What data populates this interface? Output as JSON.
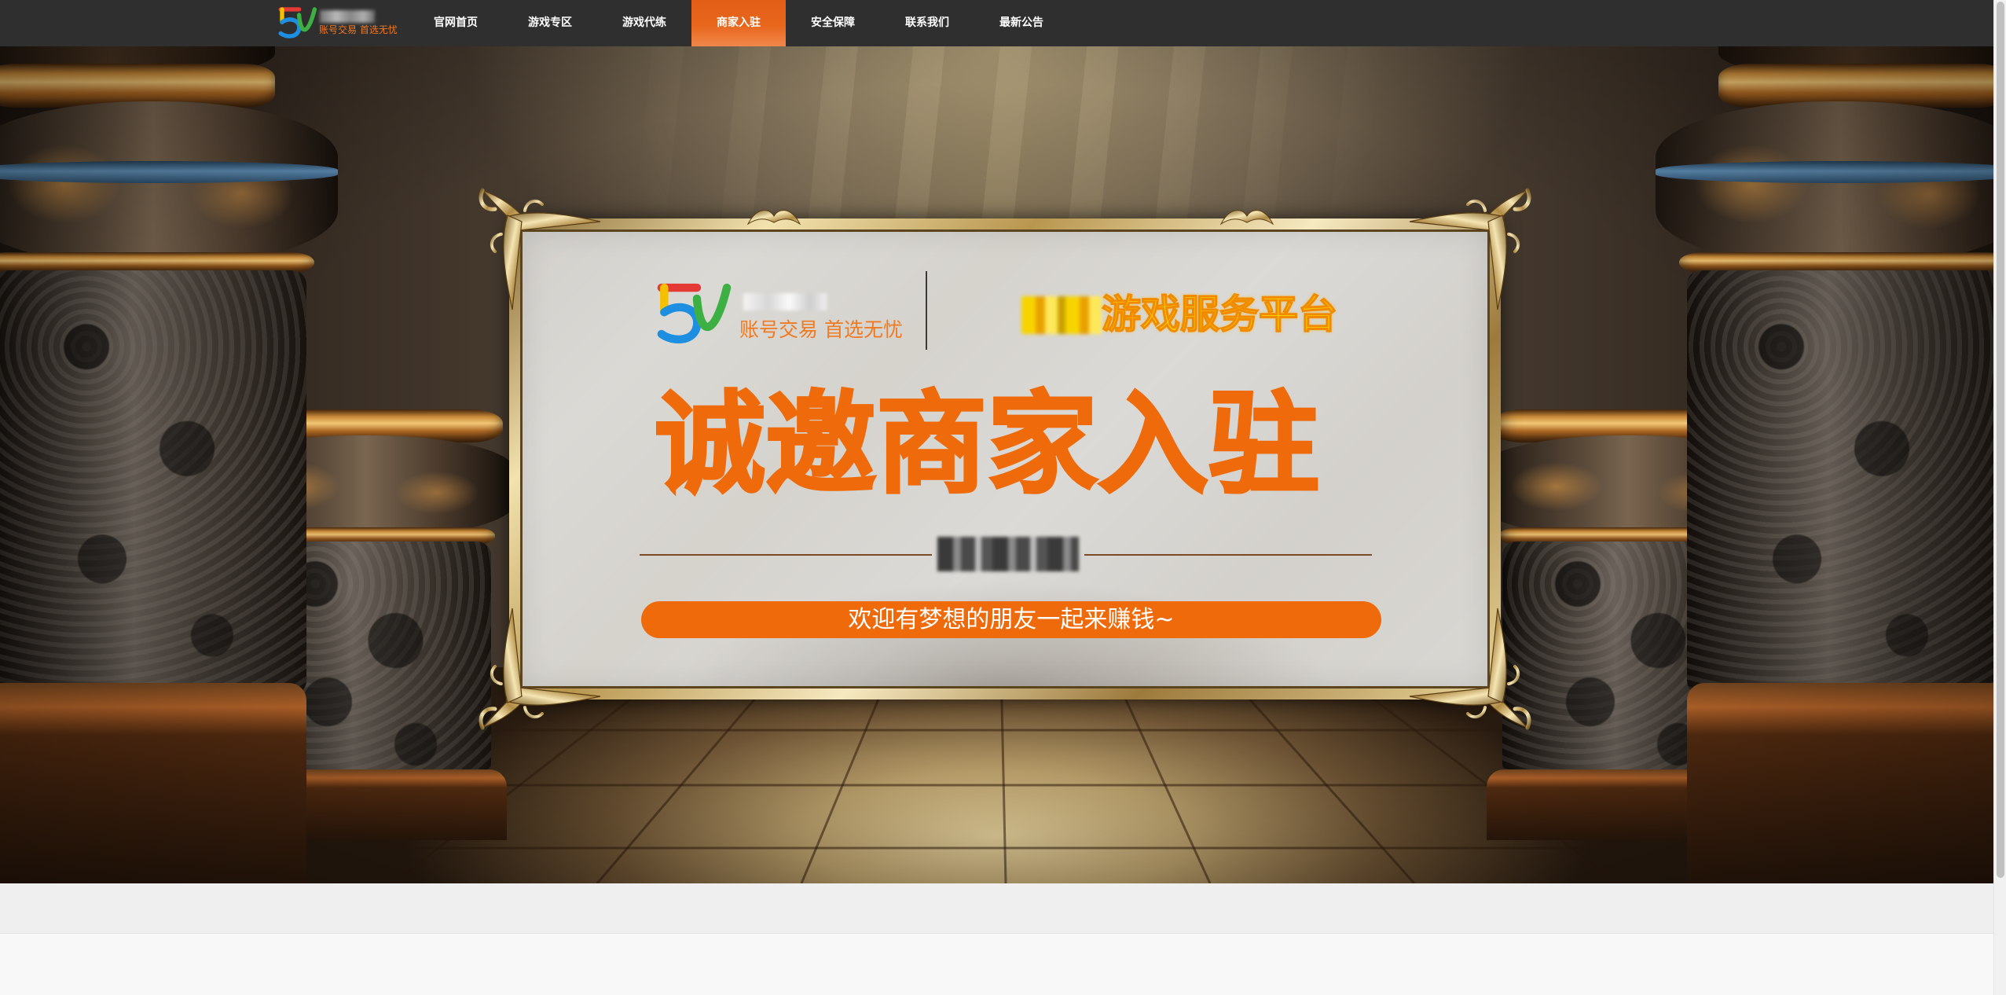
{
  "header": {
    "logo": {
      "icon": "logo-5-mark-icon",
      "slogan": "账号交易 首选无忧"
    }
  },
  "nav": {
    "items": [
      {
        "label": "官网首页",
        "active": false
      },
      {
        "label": "游戏专区",
        "active": false
      },
      {
        "label": "游戏代练",
        "active": false
      },
      {
        "label": "商家入驻",
        "active": true
      },
      {
        "label": "安全保障",
        "active": false
      },
      {
        "label": "联系我们",
        "active": false
      },
      {
        "label": "最新公告",
        "active": false
      }
    ]
  },
  "hero": {
    "panel": {
      "logo_icon": "logo-5-mark-icon",
      "logo_slogan": "账号交易 首选无忧",
      "platform_tagline": "游戏服务平台",
      "headline": "诚邀商家入驻",
      "cta_text": "欢迎有梦想的朋友一起来赚钱~"
    }
  },
  "colors": {
    "navbar_bg": "#2f2f2f",
    "nav_active_bg": "#e8661c",
    "accent_orange": "#ef6a0b",
    "tagline_yellow": "#ffe300",
    "logo_slogan_orange": "#f07a22"
  }
}
